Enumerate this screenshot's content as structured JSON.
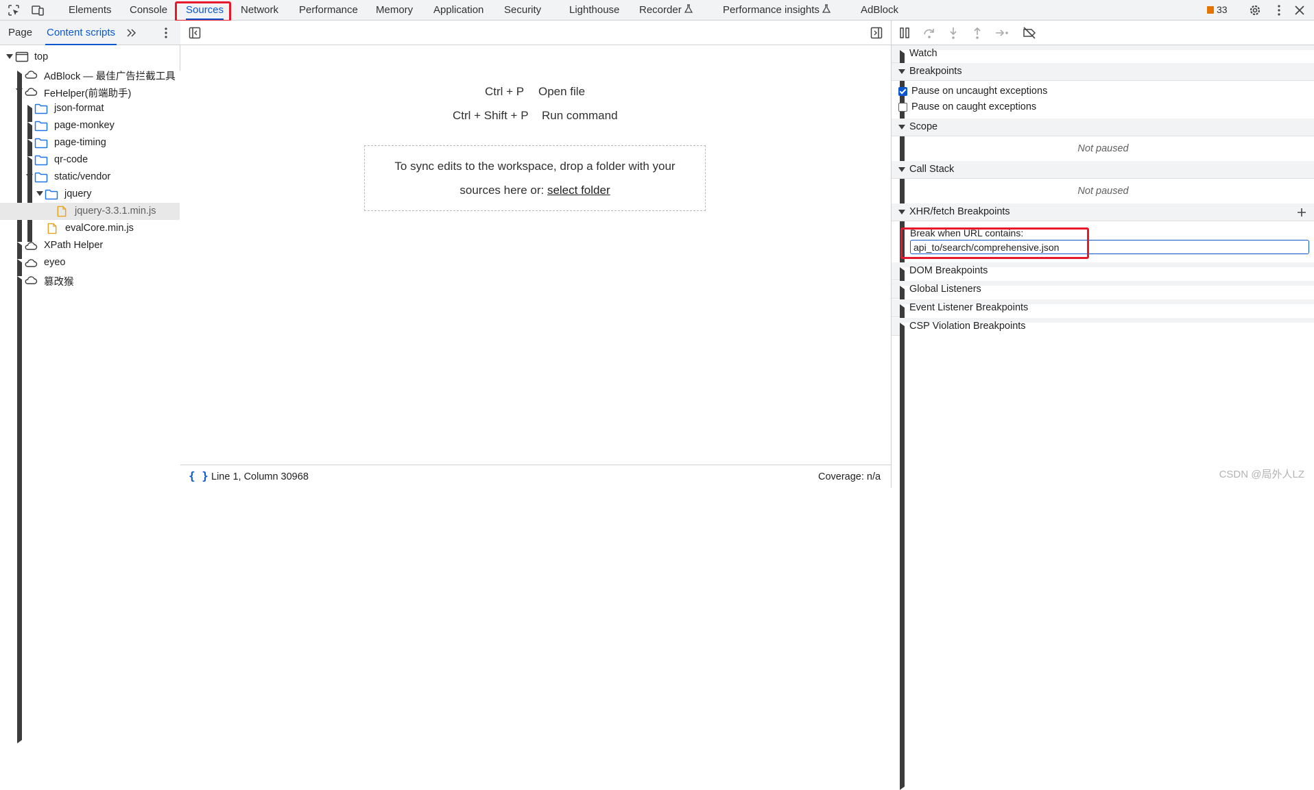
{
  "toolbar": {
    "tabs": [
      "Elements",
      "Console",
      "Sources",
      "Network",
      "Performance",
      "Memory",
      "Application",
      "Security",
      "Lighthouse",
      "Recorder",
      "Performance insights",
      "AdBlock"
    ],
    "active_tab": "Sources",
    "issues_count": "33"
  },
  "navigator": {
    "tabs": [
      "Page",
      "Content scripts"
    ],
    "active_tab": "Content scripts",
    "tree": [
      {
        "label": "top",
        "type": "frame",
        "expanded": true
      },
      {
        "label": "AdBlock — 最佳广告拦截工具",
        "type": "extension",
        "expanded": false
      },
      {
        "label": "FeHelper(前端助手)",
        "type": "extension",
        "expanded": true
      },
      {
        "label": "json-format",
        "type": "folder",
        "expanded": false
      },
      {
        "label": "page-monkey",
        "type": "folder",
        "expanded": false
      },
      {
        "label": "page-timing",
        "type": "folder",
        "expanded": false
      },
      {
        "label": "qr-code",
        "type": "folder",
        "expanded": false
      },
      {
        "label": "static/vendor",
        "type": "folder",
        "expanded": true
      },
      {
        "label": "jquery",
        "type": "folder",
        "expanded": true
      },
      {
        "label": "jquery-3.3.1.min.js",
        "type": "file",
        "selected": true
      },
      {
        "label": "evalCore.min.js",
        "type": "file"
      },
      {
        "label": "XPath Helper",
        "type": "extension",
        "expanded": false
      },
      {
        "label": "eyeo",
        "type": "extension",
        "expanded": false
      },
      {
        "label": "篡改猴",
        "type": "extension",
        "expanded": false
      }
    ]
  },
  "editor": {
    "shortcuts": [
      {
        "keys": "Ctrl + P",
        "action": "Open file"
      },
      {
        "keys": "Ctrl + Shift + P",
        "action": "Run command"
      }
    ],
    "dropzone_text_1": "To sync edits to the workspace, drop a folder with your",
    "dropzone_text_2": "sources here or:",
    "dropzone_link": "select folder",
    "status_position": "Line 1, Column 30968",
    "status_coverage": "Coverage: n/a"
  },
  "debugger": {
    "watch": "Watch",
    "breakpoints": "Breakpoints",
    "pause_uncaught": "Pause on uncaught exceptions",
    "pause_uncaught_checked": true,
    "pause_caught": "Pause on caught exceptions",
    "pause_caught_checked": false,
    "scope": "Scope",
    "scope_status": "Not paused",
    "call_stack": "Call Stack",
    "call_stack_status": "Not paused",
    "xhr_breakpoints": "XHR/fetch Breakpoints",
    "xhr_label": "Break when URL contains:",
    "xhr_value": "api_to/search/comprehensive.json",
    "dom_breakpoints": "DOM Breakpoints",
    "global_listeners": "Global Listeners",
    "event_listener_breakpoints": "Event Listener Breakpoints",
    "csp_breakpoints": "CSP Violation Breakpoints"
  },
  "watermark": "CSDN @局外人LZ",
  "colors": {
    "accent": "#0b57d0",
    "highlight": "#e8182c",
    "folder": "#1a73e8",
    "file": "#e8a21a"
  }
}
